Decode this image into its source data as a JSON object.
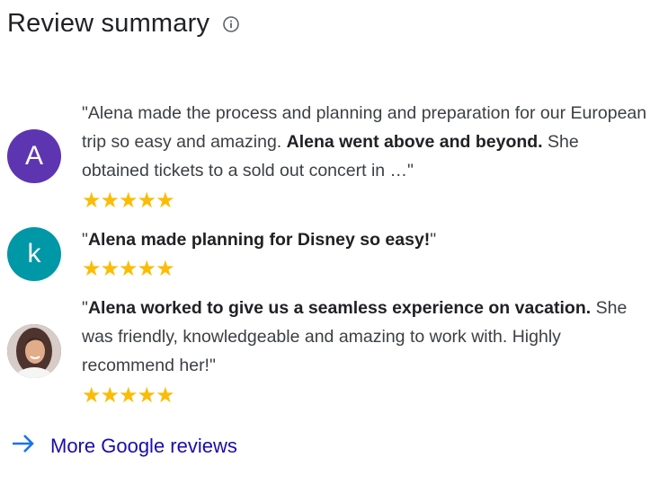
{
  "header": {
    "title": "Review summary",
    "info_icon": "info-icon"
  },
  "reviews": [
    {
      "avatar_letter": "A",
      "avatar_color": "#5e35b1",
      "text_pre": "\"Alena made the process and planning and preparation for our European trip so easy and amazing. ",
      "text_bold": "Alena went above and beyond.",
      "text_post": " She obtained tickets to a sold out concert in …\"",
      "rating": 5,
      "stars": "★★★★★"
    },
    {
      "avatar_letter": "k",
      "avatar_color": "#0097a7",
      "text_pre": "\"",
      "text_bold": "Alena made planning for Disney so easy!",
      "text_post": "\"",
      "rating": 5,
      "stars": "★★★★★"
    },
    {
      "avatar_photo": "profile-photo",
      "text_pre": "\"",
      "text_bold": "Alena worked to give us a seamless experience on vacation.",
      "text_post": " She was friendly, knowledgeable and amazing to work with. Highly recommend her!\"",
      "rating": 5,
      "stars": "★★★★★"
    }
  ],
  "more_link": {
    "label": "More Google reviews",
    "icon": "arrow-right-icon",
    "color": "#1a0dab",
    "icon_color": "#1a73e8"
  },
  "colors": {
    "star": "#fbbc04"
  }
}
